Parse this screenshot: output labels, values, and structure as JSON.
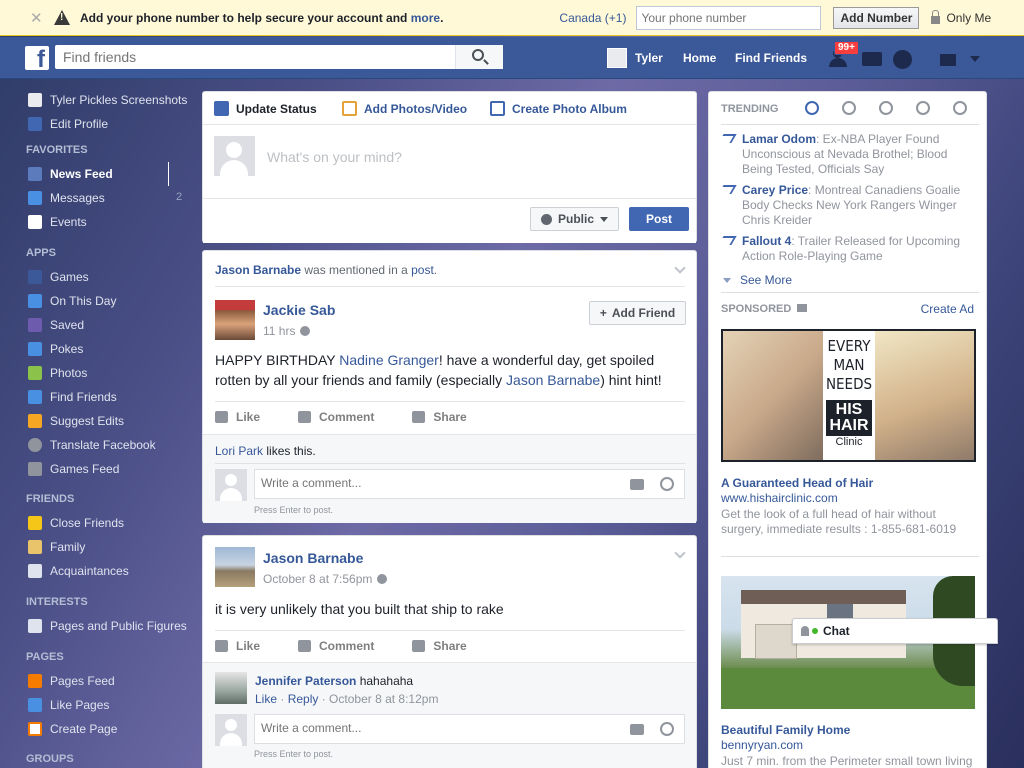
{
  "notice": {
    "message": "Add your phone number to help secure your account and",
    "more_link": "more",
    "period": ".",
    "country": "Canada (+1)",
    "phone_placeholder": "Your phone number",
    "add_button": "Add Number",
    "privacy": "Only Me"
  },
  "header": {
    "logo": "f",
    "search_placeholder": "Find friends",
    "user_name": "Tyler",
    "home": "Home",
    "find_friends": "Find Friends",
    "notification_badge": "99+"
  },
  "sidebar": {
    "profile_name": "Tyler Pickles Screenshots",
    "edit_profile": "Edit Profile",
    "favorites_header": "FAVORITES",
    "favorites": [
      {
        "label": "News Feed",
        "count": ""
      },
      {
        "label": "Messages",
        "count": "2"
      },
      {
        "label": "Events",
        "count": ""
      }
    ],
    "apps_header": "APPS",
    "apps": [
      "Games",
      "On This Day",
      "Saved",
      "Pokes",
      "Photos",
      "Find Friends",
      "Suggest Edits",
      "Translate Facebook",
      "Games Feed"
    ],
    "friends_header": "FRIENDS",
    "friends": [
      "Close Friends",
      "Family",
      "Acquaintances"
    ],
    "interests_header": "INTERESTS",
    "interests": [
      "Pages and Public Figures"
    ],
    "pages_header": "PAGES",
    "pages": [
      "Pages Feed",
      "Like Pages",
      "Create Page"
    ],
    "groups_header": "GROUPS"
  },
  "composer": {
    "tab_status": "Update Status",
    "tab_photos": "Add Photos/Video",
    "tab_album": "Create Photo Album",
    "placeholder": "What's on your mind?",
    "audience": "Public",
    "post_button": "Post"
  },
  "post1": {
    "mention_name": "Jason Barnabe",
    "mention_text": " was mentioned in a ",
    "mention_link": "post",
    "mention_end": ".",
    "author": "Jackie Sab",
    "time": "11 hrs",
    "add_friend": "Add Friend",
    "text_1": "HAPPY BIRTHDAY ",
    "link_1": "Nadine Granger",
    "text_2": "! have a wonderful day, get spoiled rotten by all your friends and family (especially ",
    "link_2": "Jason Barnabe",
    "text_3": ") hint hint!",
    "like": "Like",
    "comment": "Comment",
    "share": "Share",
    "liker": "Lori Park",
    "likes_suffix": " likes this.",
    "comment_placeholder": "Write a comment...",
    "press_enter": "Press Enter to post."
  },
  "post2": {
    "author": "Jason Barnabe",
    "time": "October 8 at 7:56pm",
    "text": "it is very unlikely that you built that ship to rake",
    "like": "Like",
    "comment": "Comment",
    "share": "Share",
    "reply_author": "Jennifer Paterson",
    "reply_text": " hahahaha",
    "reply_like": "Like",
    "reply_reply": "Reply",
    "reply_time": "October 8 at 8:12pm",
    "comment_placeholder": "Write a comment...",
    "press_enter": "Press Enter to post."
  },
  "trending": {
    "header": "TRENDING",
    "items": [
      {
        "name": "Lamar Odom",
        "text": ": Ex-NBA Player Found Unconscious at Nevada Brothel; Blood Being Tested, Officials Say"
      },
      {
        "name": "Carey Price",
        "text": ": Montreal Canadiens Goalie Body Checks New York Rangers Winger Chris Kreider"
      },
      {
        "name": "Fallout 4",
        "text": ": Trailer Released for Upcoming Action Role-Playing Game"
      }
    ],
    "see_more": "See More"
  },
  "sponsored": {
    "header": "SPONSORED",
    "create_ad": "Create Ad",
    "ad1": {
      "img_words": [
        "EVERY",
        "MAN",
        "NEEDS"
      ],
      "img_brand": "HIS HAIR",
      "img_clinic": "Clinic",
      "title": "A Guaranteed Head of Hair",
      "url": "www.hishairclinic.com",
      "desc": "Get the look of a full head of hair without surgery, immediate results : 1-855-681-6019"
    },
    "ad2": {
      "title": "Beautiful Family Home",
      "url": "bennyryan.com",
      "desc": "Just 7 min. from the Perimeter small town living"
    }
  },
  "chat": {
    "label": "Chat"
  }
}
